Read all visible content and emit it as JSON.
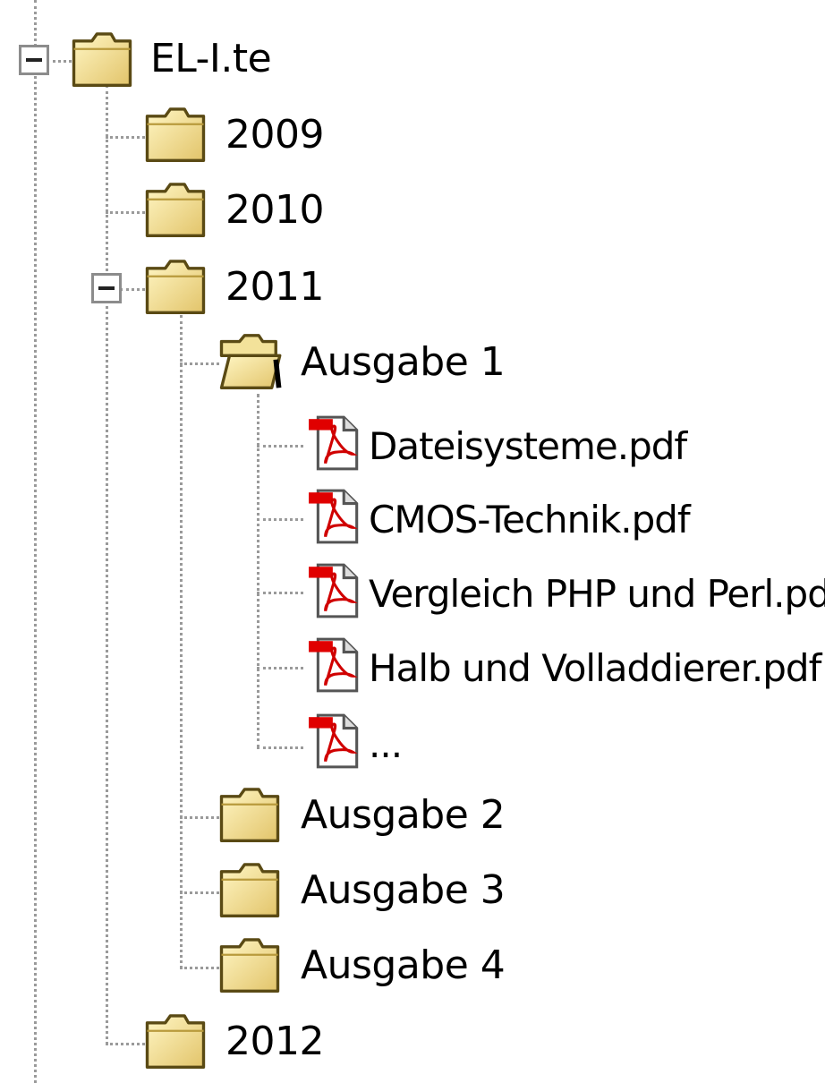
{
  "tree": {
    "root": {
      "label": "EL-I.te",
      "expanded": true,
      "icon": "folder-icon"
    },
    "years": [
      {
        "label": "2009",
        "icon": "folder-icon"
      },
      {
        "label": "2010",
        "icon": "folder-icon"
      },
      {
        "label": "2011",
        "icon": "folder-icon",
        "expanded": true
      },
      {
        "label": "2012",
        "icon": "folder-icon"
      }
    ],
    "issues": [
      {
        "label": "Ausgabe 1",
        "icon": "open-folder-icon",
        "expanded": true
      },
      {
        "label": "Ausgabe 2",
        "icon": "folder-icon"
      },
      {
        "label": "Ausgabe 3",
        "icon": "folder-icon"
      },
      {
        "label": "Ausgabe 4",
        "icon": "folder-icon"
      }
    ],
    "files": [
      {
        "label": "Dateisysteme.pdf",
        "icon": "pdf-file-icon"
      },
      {
        "label": "CMOS-Technik.pdf",
        "icon": "pdf-file-icon"
      },
      {
        "label": "Vergleich PHP und Perl.pdf",
        "icon": "pdf-file-icon"
      },
      {
        "label": "Halb und Volladdierer.pdf",
        "icon": "pdf-file-icon"
      },
      {
        "label": "...",
        "icon": "pdf-file-icon"
      }
    ]
  }
}
